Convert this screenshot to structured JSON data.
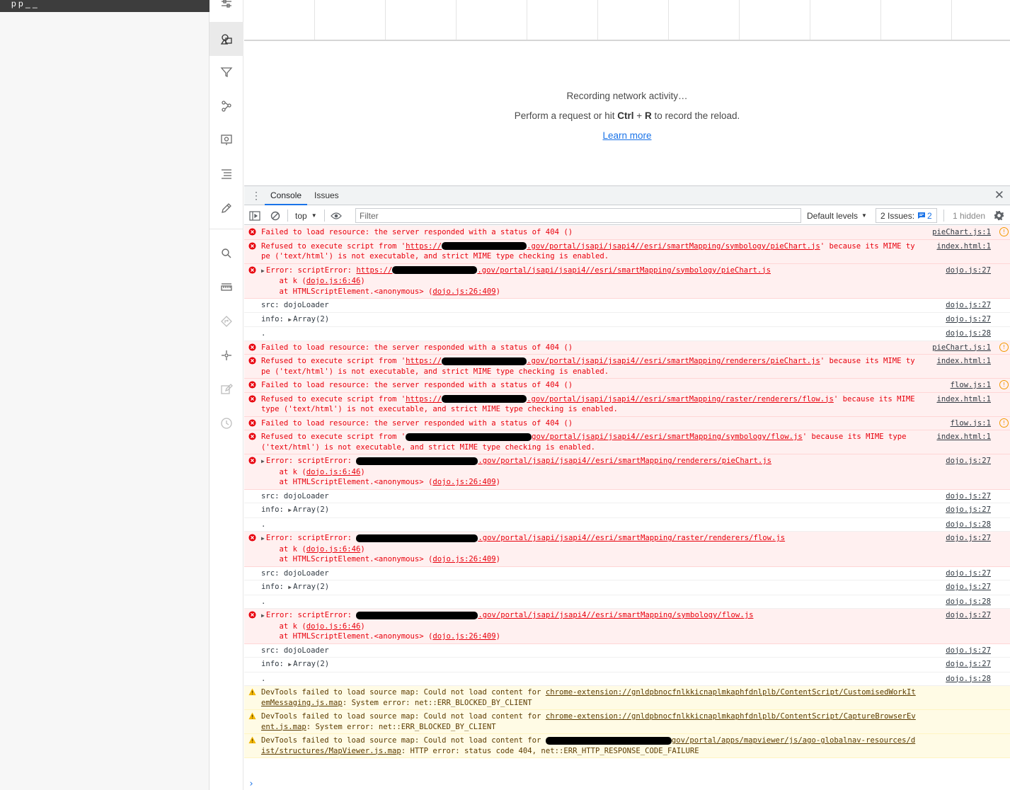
{
  "left": {
    "top_text": "p    p _ _"
  },
  "network": {
    "recording_text": "Recording network activity…",
    "perform_prefix": "Perform a request or hit ",
    "key1": "Ctrl",
    "plus": " + ",
    "key2": "R",
    "perform_suffix": " to record the reload.",
    "learn_more": "Learn more"
  },
  "drawer": {
    "tabs": [
      {
        "label": "Console"
      },
      {
        "label": "Issues"
      }
    ],
    "toolbar": {
      "context": "top",
      "filter_placeholder": "Filter",
      "levels": "Default levels",
      "issues_label": "2 Issues:",
      "issues_count": "2",
      "hidden": "1 hidden"
    }
  },
  "console": {
    "messages": [
      {
        "type": "error",
        "text": "Failed to load resource: the server responded with a status of 404 ()",
        "link": "pieChart.js:1",
        "flag": true
      },
      {
        "type": "error",
        "pre": "Refused to execute script from '",
        "url_a": "https://",
        "redact": 120,
        "url_b": ".gov/portal/jsapi/jsapi4//esri/smartMapping/symbology/pieChart.js",
        "post": "' because its MIME type ('text/html') is not executable, and strict MIME type checking is enabled.",
        "link": "index.html:1"
      },
      {
        "type": "error",
        "expand": true,
        "pre": "Error: scriptError: ",
        "url_a": "https://",
        "redact": 120,
        "url_b": ".gov/portal/jsapi/jsapi4//esri/smartMapping/symbology/pieChart.js",
        "stack1": "    at k (",
        "stack1_link": "dojo.js:6:46",
        "stack2": "    at HTMLScriptElement.<anonymous> (",
        "stack2_link": "dojo.js:26:409",
        "link": "dojo.js:27"
      },
      {
        "type": "log",
        "text": "src: dojoLoader",
        "link": "dojo.js:27"
      },
      {
        "type": "log",
        "pre": "info: ",
        "arr": "Array(2)",
        "link": "dojo.js:27"
      },
      {
        "type": "log",
        "text": ".",
        "link": "dojo.js:28"
      },
      {
        "type": "error",
        "text": "Failed to load resource: the server responded with a status of 404 ()",
        "link": "pieChart.js:1",
        "flag": true
      },
      {
        "type": "error",
        "pre": "Refused to execute script from '",
        "url_a": "https://",
        "redact": 120,
        "url_b": ".gov/portal/jsapi/jsapi4//esri/smartMapping/renderers/pieChart.js",
        "post": "' because its MIME type ('text/html') is not executable, and strict MIME type checking is enabled.",
        "link": "index.html:1"
      },
      {
        "type": "error",
        "text": "Failed to load resource: the server responded with a status of 404 ()",
        "link": "flow.js:1",
        "flag": true
      },
      {
        "type": "error",
        "pre": "Refused to execute script from '",
        "url_a": "https://",
        "redact": 120,
        "url_b": ".gov/portal/jsapi/jsapi4//esri/smartMapping/raster/renderers/flow.js",
        "post": "' because its MIME type ('text/html') is not executable, and strict MIME type checking is enabled.",
        "link": "index.html:1"
      },
      {
        "type": "error",
        "text": "Failed to load resource: the server responded with a status of 404 ()",
        "link": "flow.js:1",
        "flag": true
      },
      {
        "type": "error",
        "pre": "Refused to execute script from '",
        "url_a": "",
        "redact": 178,
        "url_b": "gov/portal/jsapi/jsapi4//esri/smartMapping/symbology/flow.js",
        "post": "' because its MIME type ('text/html') is not executable, and strict MIME type checking is enabled.",
        "link": "index.html:1"
      },
      {
        "type": "error",
        "expand": true,
        "pre": "Error: scriptError: ",
        "url_a": "",
        "redact": 172,
        "url_b": ".gov/portal/jsapi/jsapi4//esri/smartMapping/renderers/pieChart.js",
        "stack1": "    at k (",
        "stack1_link": "dojo.js:6:46",
        "stack2": "    at HTMLScriptElement.<anonymous> (",
        "stack2_link": "dojo.js:26:409",
        "link": "dojo.js:27"
      },
      {
        "type": "log",
        "text": "src: dojoLoader",
        "link": "dojo.js:27"
      },
      {
        "type": "log",
        "pre": "info: ",
        "arr": "Array(2)",
        "link": "dojo.js:27"
      },
      {
        "type": "log",
        "text": ".",
        "link": "dojo.js:28"
      },
      {
        "type": "error",
        "expand": true,
        "pre": "Error: scriptError: ",
        "url_a": "",
        "redact": 172,
        "url_b": ".gov/portal/jsapi/jsapi4//esri/smartMapping/raster/renderers/flow.js",
        "stack1": "    at k (",
        "stack1_link": "dojo.js:6:46",
        "stack2": "    at HTMLScriptElement.<anonymous> (",
        "stack2_link": "dojo.js:26:409",
        "link": "dojo.js:27"
      },
      {
        "type": "log",
        "text": "src: dojoLoader",
        "link": "dojo.js:27"
      },
      {
        "type": "log",
        "pre": "info: ",
        "arr": "Array(2)",
        "link": "dojo.js:27"
      },
      {
        "type": "log",
        "text": ".",
        "link": "dojo.js:28"
      },
      {
        "type": "error",
        "expand": true,
        "pre": "Error: scriptError: ",
        "url_a": "",
        "redact": 172,
        "url_b": ".gov/portal/jsapi/jsapi4//esri/smartMapping/symbology/flow.js",
        "stack1": "    at k (",
        "stack1_link": "dojo.js:6:46",
        "stack2": "    at HTMLScriptElement.<anonymous> (",
        "stack2_link": "dojo.js:26:409",
        "link": "dojo.js:27"
      },
      {
        "type": "log",
        "text": "src: dojoLoader",
        "link": "dojo.js:27"
      },
      {
        "type": "log",
        "pre": "info: ",
        "arr": "Array(2)",
        "link": "dojo.js:27"
      },
      {
        "type": "log",
        "text": ".",
        "link": "dojo.js:28"
      },
      {
        "type": "warning",
        "pre": "DevTools failed to load source map: Could not load content for ",
        "url_b": "chrome-extension://gnldpbnocfnlkkicnaplmkaphfdnlplb/ContentScript/CustomisedWorkItemMessaging.js.map",
        "post": ": System error: net::ERR_BLOCKED_BY_CLIENT"
      },
      {
        "type": "warning",
        "pre": "DevTools failed to load source map: Could not load content for ",
        "url_b": "chrome-extension://gnldpbnocfnlkkicnaplmkaphfdnlplb/ContentScript/CaptureBrowserEvent.js.map",
        "post": ": System error: net::ERR_BLOCKED_BY_CLIENT"
      },
      {
        "type": "warning",
        "pre": "DevTools failed to load source map: Could not load content for ",
        "redact": 178,
        "url_b": "gov/portal/apps/mapviewer/js/ago-globalnav-resources/dist/structures/MapViewer.js.map",
        "post": ": HTTP error: status code 404, net::ERR_HTTP_RESPONSE_CODE_FAILURE"
      }
    ]
  },
  "colors": {
    "error_bg": "#fff0f0",
    "error_text": "#e8000c",
    "warning_bg": "#fffbe5",
    "accent": "#1a73e8"
  }
}
